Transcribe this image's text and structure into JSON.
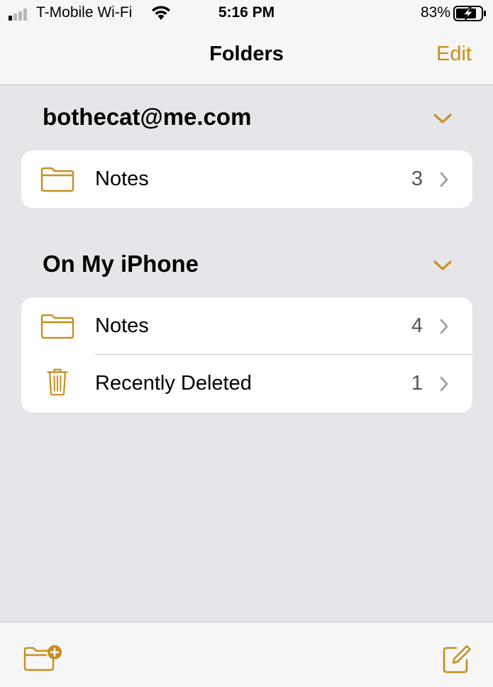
{
  "status_bar": {
    "carrier": "T-Mobile Wi-Fi",
    "time": "5:16 PM",
    "battery_percent": "83%"
  },
  "nav": {
    "title": "Folders",
    "edit_label": "Edit"
  },
  "accent_color": "#c88f1c",
  "sections": [
    {
      "header": "bothecat@me.com",
      "rows": [
        {
          "icon": "folder-icon",
          "label": "Notes",
          "count": "3"
        }
      ]
    },
    {
      "header": "On My iPhone",
      "rows": [
        {
          "icon": "folder-icon",
          "label": "Notes",
          "count": "4"
        },
        {
          "icon": "trash-icon",
          "label": "Recently Deleted",
          "count": "1"
        }
      ]
    }
  ],
  "toolbar": {
    "left_icon": "new-folder-icon",
    "right_icon": "compose-icon"
  }
}
